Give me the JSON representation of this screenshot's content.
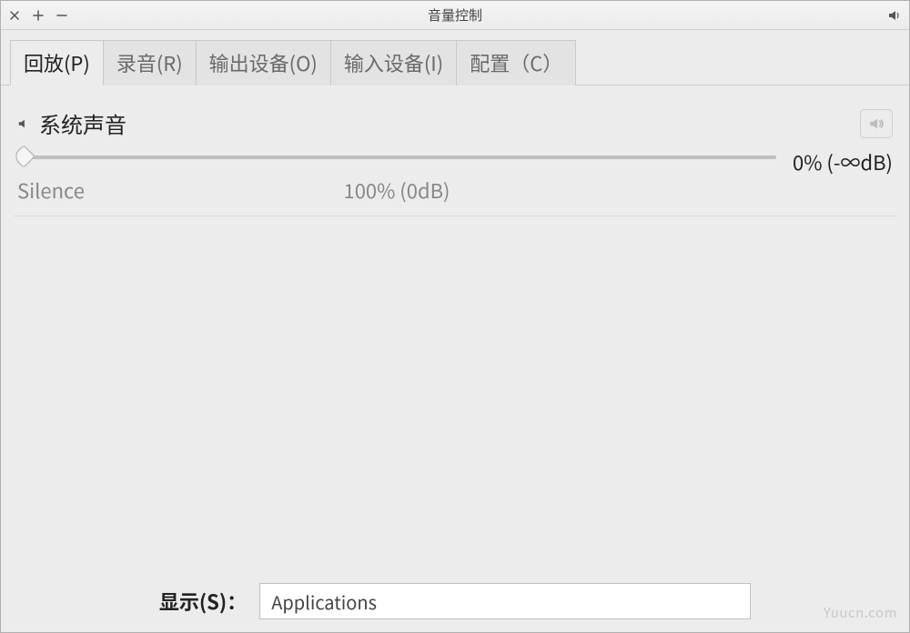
{
  "window": {
    "title": "音量控制"
  },
  "tabs": [
    {
      "label": "回放(P)",
      "active": true
    },
    {
      "label": "录音(R)",
      "active": false
    },
    {
      "label": "输出设备(O)",
      "active": false
    },
    {
      "label": "输入设备(I)",
      "active": false
    },
    {
      "label": "配置（C）",
      "active": false
    }
  ],
  "stream": {
    "name": "系统声音",
    "slider": {
      "left_label": "Silence",
      "center_label": "100% (0dB)",
      "value_percent": 0
    },
    "readout": "0% (-∞dB)"
  },
  "show": {
    "label": "显示(S)：",
    "selected": "Applications"
  },
  "watermark": "Yuucn.com",
  "icons": {
    "speaker": "speaker-icon",
    "speaker_muted": "speaker-muted-icon"
  }
}
